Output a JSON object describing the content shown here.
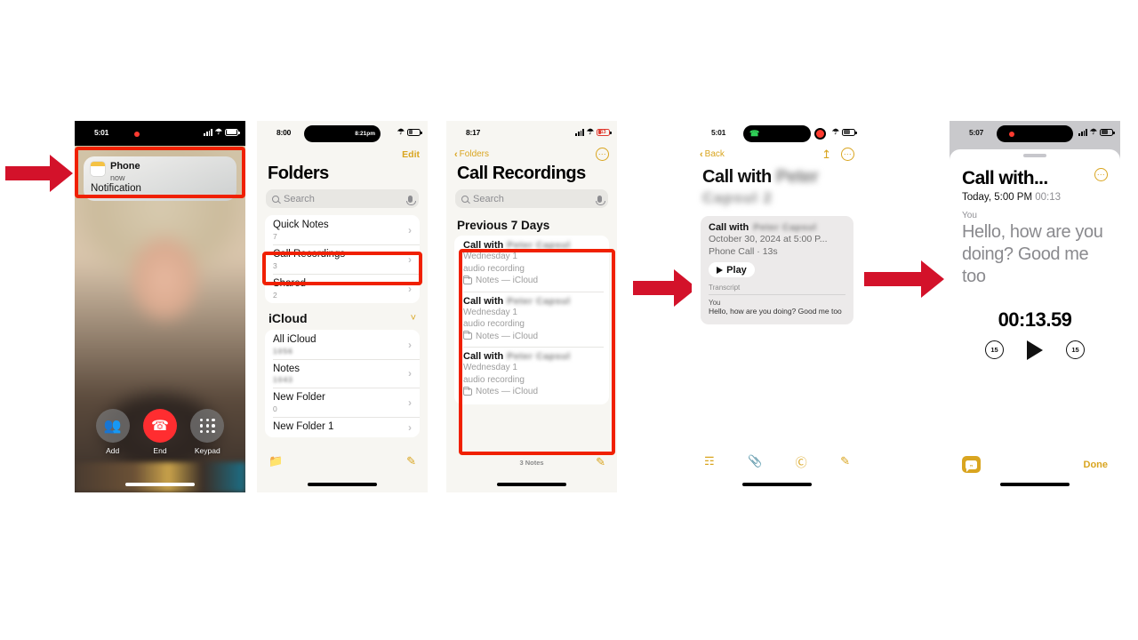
{
  "meta": {
    "accent_gold": "#d9a520",
    "callout_red": "#f02000",
    "arrow_red": "#d3122a"
  },
  "phone1": {
    "name": "in-call-screen",
    "status": {
      "time": "5:01",
      "battery_level": "50"
    },
    "notification": {
      "app": "Phone",
      "time": "now",
      "body": "Notification",
      "icon": "notes-app-icon"
    },
    "controls": [
      {
        "label": "Add",
        "icon": "add-call-icon"
      },
      {
        "label": "End",
        "icon": "end-call-icon"
      },
      {
        "label": "Keypad",
        "icon": "keypad-icon"
      }
    ]
  },
  "phone2": {
    "name": "notes-folders-screen",
    "status": {
      "time": "8:00",
      "island_label": "8:21pm"
    },
    "nav": {
      "edit": "Edit"
    },
    "title": "Folders",
    "search_placeholder": "Search",
    "folders": [
      {
        "name": "Quick Notes",
        "count": "7",
        "blurred": false
      },
      {
        "name": "Call Recordings",
        "count": "3",
        "blurred": false
      },
      {
        "name": "Shared",
        "count": "2",
        "blurred": false
      }
    ],
    "section": {
      "title": "iCloud",
      "chevron": "chevron-down-icon"
    },
    "icloud_folders": [
      {
        "name": "All iCloud",
        "count": "1056",
        "blurred": true
      },
      {
        "name": "Notes",
        "count": "1043",
        "blurred": true
      },
      {
        "name": "New Folder",
        "count": "0",
        "blurred": false
      },
      {
        "name": "New Folder 1",
        "count": "",
        "blurred": false
      }
    ],
    "toolbar": {
      "new_folder": "new-folder-icon",
      "compose": "compose-icon"
    }
  },
  "phone3": {
    "name": "call-recordings-screen",
    "status": {
      "time": "8:17",
      "battery_level": "13"
    },
    "nav": {
      "back": "Folders",
      "more": "more-options-icon"
    },
    "title": "Call Recordings",
    "search_placeholder": "Search",
    "section_header": "Previous 7 Days",
    "recordings": [
      {
        "prefix": "Call with",
        "contact": "Peter Capsul",
        "line2": "Wednesday  1",
        "line3": "audio recording",
        "folder": "Notes — iCloud"
      },
      {
        "prefix": "Call with",
        "contact": "Peter Capsul",
        "line2": "Wednesday  1",
        "line3": "audio recording",
        "folder": "Notes — iCloud"
      },
      {
        "prefix": "Call with",
        "contact": "Peter Capsul",
        "line2": "Wednesday  1",
        "line3": "audio recording",
        "folder": "Notes — iCloud"
      }
    ],
    "footer": {
      "count": "3 Notes",
      "compose": "compose-icon"
    }
  },
  "phone4": {
    "name": "note-detail-screen",
    "status": {
      "time": "5:01"
    },
    "nav": {
      "back": "Back",
      "share": "share-icon",
      "more": "more-options-icon"
    },
    "title_prefix": "Call with",
    "title_blurred": "Peter",
    "subtitle_blurred": "Capsul 2",
    "attachment": {
      "title_prefix": "Call with",
      "title_blurred": "Peter Capsul",
      "datetime": "October 30, 2024 at 5:00 P...",
      "type": "Phone Call · 13s",
      "play_label": "Play"
    },
    "transcript": {
      "label": "Transcript",
      "speaker": "You",
      "text": "Hello, how are you doing? Good me too"
    },
    "toolbar": [
      {
        "icon": "checklist-icon"
      },
      {
        "icon": "attachment-icon"
      },
      {
        "icon": "markup-icon"
      },
      {
        "icon": "compose-icon"
      }
    ]
  },
  "phone5": {
    "name": "transcript-playback-sheet",
    "status": {
      "time": "5:07"
    },
    "title": "Call with...",
    "more": "more-options-icon",
    "meta_date": "Today, 5:00 PM",
    "meta_duration": "00:13",
    "speaker": "You",
    "transcript_text": "Hello, how are you doing? Good me too",
    "timer": "00:13.59",
    "transport": {
      "back15": "15",
      "play": "play-icon",
      "forward15": "15"
    },
    "footer": {
      "quote_icon": "transcript-toggle-icon",
      "done": "Done"
    }
  },
  "arrows": [
    {
      "name": "arrow-to-notification"
    },
    {
      "name": "arrow-to-call-recordings-note"
    },
    {
      "name": "arrow-to-transcript"
    }
  ]
}
